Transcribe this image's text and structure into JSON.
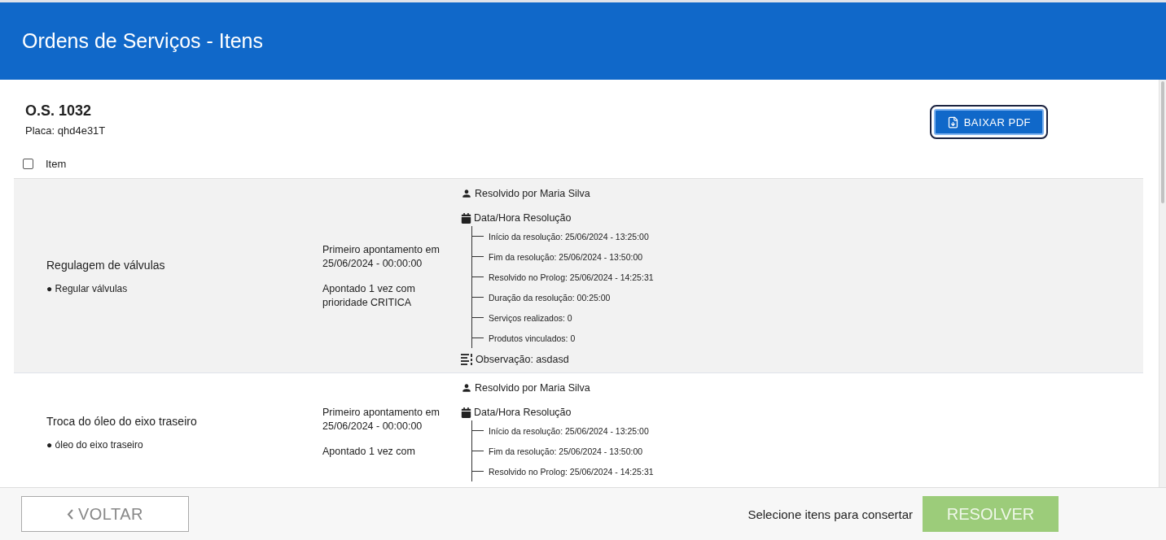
{
  "header": {
    "title": "Ordens de Serviços - Itens"
  },
  "order": {
    "title": "O.S. 1032",
    "plate": "Placa: qhd4e31T"
  },
  "download_button": {
    "label": "BAIXAR PDF"
  },
  "table": {
    "select_all": {
      "checked": false
    },
    "column_label": "Item",
    "rows": [
      {
        "highlighted": true,
        "name": "Regulagem de válvulas",
        "service": "● Regular válvulas",
        "first_report": "Primeiro apontamento em 25/06/2024 - 00:00:00",
        "reported": "Apontado 1 vez com prioridade CRITICA",
        "resolved_by": "Resolvido por Maria Silva",
        "datetime_title": "Data/Hora Resolução",
        "details": [
          "Início da resolução: 25/06/2024 - 13:25:00",
          "Fim da resolução: 25/06/2024 - 13:50:00",
          "Resolvido no Prolog: 25/06/2024 - 14:25:31",
          "Duração da resolução: 00:25:00",
          "Serviços realizados: 0",
          "Produtos vinculados: 0"
        ],
        "note": "Observação: asdasd"
      },
      {
        "highlighted": false,
        "name": "Troca do óleo do eixo traseiro",
        "service": "● óleo do eixo traseiro",
        "first_report": "Primeiro apontamento em 25/06/2024 - 00:00:00",
        "reported": "Apontado 1 vez com",
        "resolved_by": "Resolvido por Maria Silva",
        "datetime_title": "Data/Hora Resolução",
        "details": [
          "Início da resolução: 25/06/2024 - 13:25:00",
          "Fim da resolução: 25/06/2024 - 13:50:00",
          "Resolvido no Prolog: 25/06/2024 - 14:25:31"
        ]
      }
    ]
  },
  "footer": {
    "back_button": "VOLTAR",
    "hint": "Selecione itens para consertar",
    "resolve_button": {
      "label": "RESOLVER",
      "disabled": true
    }
  }
}
